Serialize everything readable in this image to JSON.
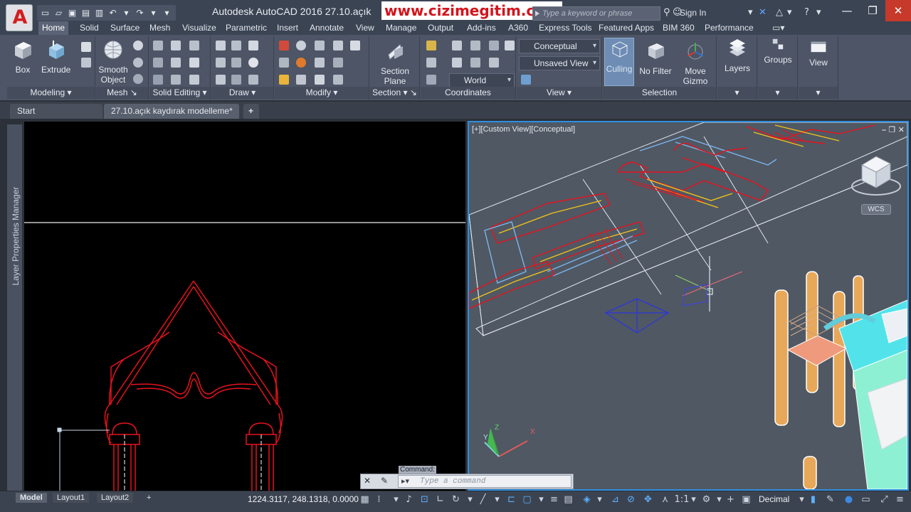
{
  "titlebar": {
    "app_logo": "A",
    "window_title": "Autodesk AutoCAD 2016    27.10.açık",
    "watermark": "www.cizimegitim.com",
    "search_placeholder": "Type a keyword or phrase",
    "sign_in": "Sign In"
  },
  "ribbon_tabs": [
    "Home",
    "Solid",
    "Surface",
    "Mesh",
    "Visualize",
    "Parametric",
    "Insert",
    "Annotate",
    "View",
    "Manage",
    "Output",
    "Add-ins",
    "A360",
    "Express Tools",
    "Featured Apps",
    "BIM 360",
    "Performance"
  ],
  "ribbon": {
    "modeling": {
      "title": "Modeling",
      "box": "Box",
      "extrude": "Extrude"
    },
    "mesh": {
      "title": "Mesh",
      "smooth_object_1": "Smooth",
      "smooth_object_2": "Object"
    },
    "solid_editing": {
      "title": "Solid Editing"
    },
    "draw": {
      "title": "Draw"
    },
    "modify": {
      "title": "Modify"
    },
    "section": {
      "title": "Section",
      "section_plane_1": "Section",
      "section_plane_2": "Plane"
    },
    "coordinates": {
      "title": "Coordinates",
      "world": "World"
    },
    "view": {
      "title": "View",
      "visual_style": "Conceptual",
      "saved_view": "Unsaved View"
    },
    "selection": {
      "title": "Selection",
      "culling": "Culling",
      "no_filter": "No Filter",
      "move_gizmo_1": "Move",
      "move_gizmo_2": "Gizmo"
    },
    "layers": "Layers",
    "groups": "Groups",
    "view_btn": "View"
  },
  "doc_tabs": {
    "start": "Start",
    "active": "27.10.açık kaydırak modelleme*",
    "new_tab": "+"
  },
  "palette": {
    "label": "Layer Properties Manager"
  },
  "viewport_right": {
    "label": "[+][Custom View][Conceptual]",
    "wcs": "WCS"
  },
  "command": {
    "caption": "Command:",
    "placeholder": "Type a command"
  },
  "status": {
    "layouts": [
      "Model",
      "Layout1",
      "Layout2"
    ],
    "coords": "1224.3117, 248.1318, 0.0000",
    "scale": "1:1",
    "units": "Decimal"
  },
  "colors": {
    "accent": "#2f8fe0",
    "drawing_red": "#e8121e",
    "watermark_red": "#d4141c"
  }
}
